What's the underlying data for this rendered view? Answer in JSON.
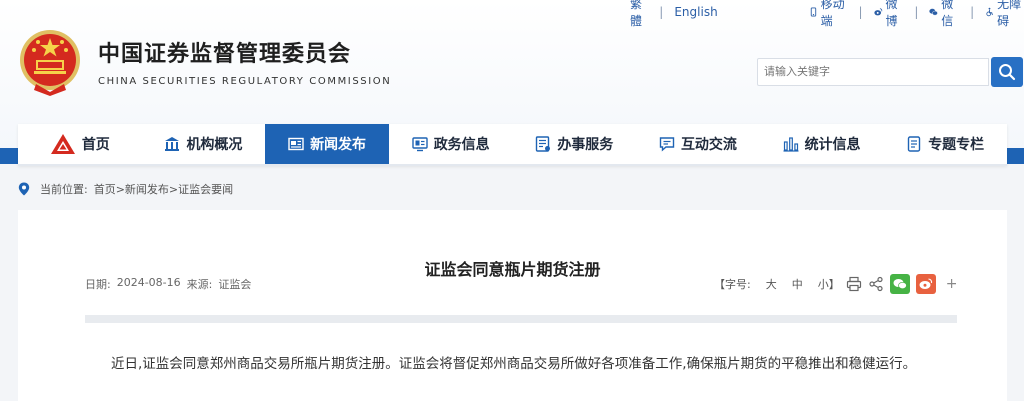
{
  "top_links": {
    "traditional": "繁體",
    "english": "English",
    "mobile": "移动端",
    "weibo": "微博",
    "wechat": "微信",
    "accessible": "无障碍"
  },
  "site": {
    "title_cn": "中国证券监督管理委员会",
    "title_en": "CHINA SECURITIES REGULATORY COMMISSION"
  },
  "search": {
    "placeholder": "请输入关键字"
  },
  "nav": {
    "items": [
      {
        "label": "首页",
        "icon": "csrc-logo-icon"
      },
      {
        "label": "机构概况",
        "icon": "building-icon"
      },
      {
        "label": "新闻发布",
        "icon": "news-icon"
      },
      {
        "label": "政务信息",
        "icon": "monitor-icon"
      },
      {
        "label": "办事服务",
        "icon": "document-list-icon"
      },
      {
        "label": "互动交流",
        "icon": "chat-icon"
      },
      {
        "label": "统计信息",
        "icon": "bar-chart-icon"
      },
      {
        "label": "专题专栏",
        "icon": "book-icon"
      }
    ],
    "active_index": 2
  },
  "breadcrumb": {
    "label": "当前位置:",
    "path": "首页>新闻发布>证监会要闻"
  },
  "article": {
    "title": "证监会同意瓶片期货注册",
    "date_label": "日期:",
    "date": "2024-08-16",
    "source_label": "来源:",
    "source": "证监会",
    "font_size_label": "【字号:",
    "font_large": "大",
    "font_medium": "中",
    "font_small": "小】",
    "plus": "+",
    "body": "近日,证监会同意郑州商品交易所瓶片期货注册。证监会将督促郑州商品交易所做好各项准备工作,确保瓶片期货的平稳推出和稳健运行。"
  },
  "colors": {
    "brand_blue": "#1e63b4",
    "wechat_green": "#46b345",
    "weibo_orange": "#e8613f"
  }
}
